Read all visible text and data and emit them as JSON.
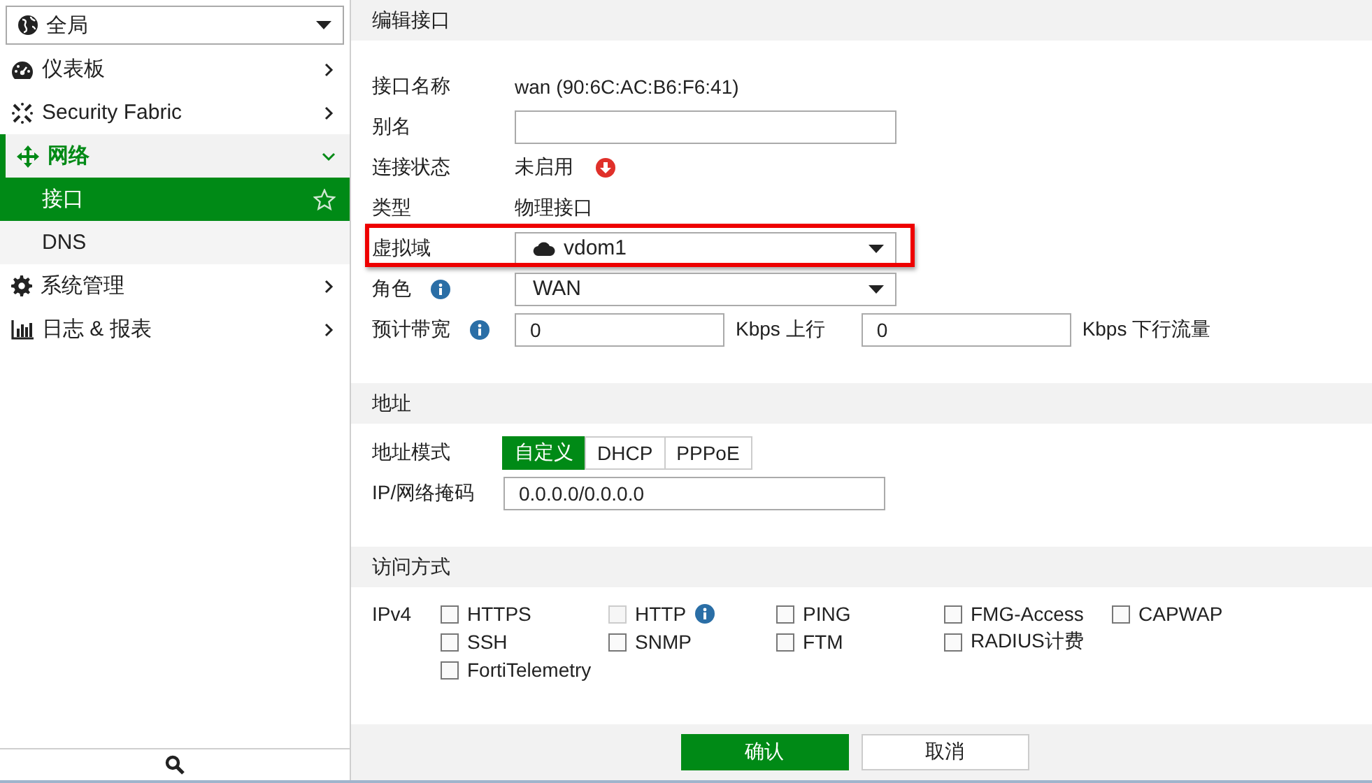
{
  "scope_select": {
    "value": "全局"
  },
  "sidebar": {
    "items": [
      {
        "label": "仪表板",
        "expanded": false
      },
      {
        "label": "Security Fabric",
        "expanded": false
      },
      {
        "label": "网络",
        "expanded": true,
        "children": [
          {
            "label": "接口",
            "selected": true,
            "favorite": false
          },
          {
            "label": "DNS",
            "selected": false
          }
        ]
      },
      {
        "label": "系统管理",
        "expanded": false
      },
      {
        "label": "日志 & 报表",
        "expanded": false
      }
    ]
  },
  "panel": {
    "title": "编辑接口",
    "fields": [
      {
        "kind": "text",
        "label": "接口名称",
        "value": "wan (90:6C:AC:B6:F6:41)"
      },
      {
        "kind": "input",
        "label": "别名"
      },
      {
        "kind": "status",
        "label": "连接状态",
        "value": "未启用",
        "up": false
      },
      {
        "kind": "text",
        "label": "类型",
        "value": "物理接口"
      },
      {
        "kind": "vdom",
        "label": "虚拟域",
        "value": "vdom1",
        "highlighted": true
      },
      {
        "kind": "select",
        "label": "角色",
        "value": "WAN",
        "info": true
      },
      {
        "kind": "bandwidth",
        "label": "预计带宽",
        "info": true,
        "upstream": "0",
        "upstream_unit": "Kbps 上行",
        "downstream": "0",
        "downstream_unit": "Kbps 下行流量"
      }
    ]
  },
  "address": {
    "title": "地址",
    "mode_label": "地址模式",
    "modes": [
      {
        "label": "自定义",
        "selected": true
      },
      {
        "label": "DHCP",
        "selected": false
      },
      {
        "label": "PPPoE",
        "selected": false
      }
    ],
    "ip_label": "IP/网络掩码",
    "ip_value": "0.0.0.0/0.0.0.0"
  },
  "access": {
    "title": "访问方式",
    "protocol": "IPv4",
    "rows": [
      [
        {
          "label": "HTTPS",
          "checked": false,
          "disabled": false
        },
        {
          "label": "HTTP",
          "checked": false,
          "disabled": true,
          "info": true
        },
        {
          "label": "PING",
          "checked": false,
          "disabled": false
        },
        {
          "label": "FMG-Access",
          "checked": false,
          "disabled": false
        },
        {
          "label": "CAPWAP",
          "checked": false,
          "disabled": false
        }
      ],
      [
        {
          "label": "SSH",
          "checked": false,
          "disabled": false
        },
        {
          "label": "SNMP",
          "checked": false,
          "disabled": false
        },
        {
          "label": "FTM",
          "checked": false,
          "disabled": false
        },
        {
          "label": "RADIUS计费",
          "checked": false,
          "disabled": false
        }
      ],
      [
        {
          "label": "FortiTelemetry",
          "checked": false,
          "disabled": false
        }
      ]
    ]
  },
  "buttons": [
    {
      "label": "确认",
      "primary": true
    },
    {
      "label": "取消",
      "primary": false
    }
  ]
}
